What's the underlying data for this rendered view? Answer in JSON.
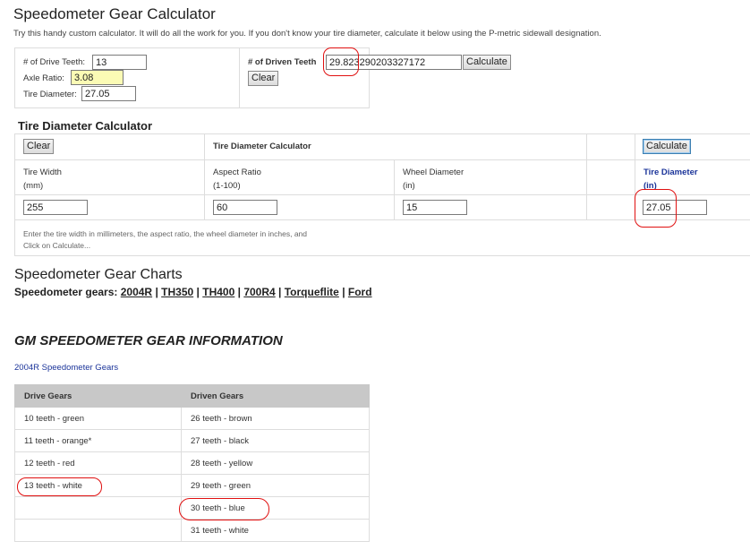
{
  "header": {
    "title": "Speedometer Gear Calculator",
    "intro": "Try this handy custom calculator. It will do all the work for you. If you don't know your tire diameter, calculate it below using the P-metric sidewall designation."
  },
  "calculator": {
    "drive_teeth_label": "# of Drive Teeth:",
    "drive_teeth_value": "13",
    "axle_ratio_label": "Axle Ratio:",
    "axle_ratio_value": "3.08",
    "tire_diameter_label": "Tire Diameter:",
    "tire_diameter_value": "27.05",
    "driven_teeth_label": "# of Driven Teeth",
    "driven_teeth_value": "29.823290203327172",
    "calculate_label": "Calculate",
    "clear_label": "Clear"
  },
  "tire_calc": {
    "heading": "Tire Diameter Calculator",
    "clear_label": "Clear",
    "header_label": "Tire Diameter Calculator",
    "calculate_label": "Calculate",
    "width_label": "Tire Width",
    "width_unit": "(mm)",
    "width_value": "255",
    "aspect_label": "Aspect Ratio",
    "aspect_unit": "(1-100)",
    "aspect_value": "60",
    "wheel_label": "Wheel Diameter",
    "wheel_unit": "(in)",
    "wheel_value": "15",
    "diameter_label": "Tire Diameter",
    "diameter_unit": "(in)",
    "diameter_value": "27.05",
    "help_line1": "Enter the tire width in millimeters, the aspect ratio, the wheel diameter in inches, and",
    "help_line2": "Click on Calculate..."
  },
  "charts": {
    "heading": "Speedometer Gear Charts",
    "prefix": "Speedometer gears:",
    "links": [
      "2004R",
      "TH350",
      "TH400",
      "700R4",
      "Torqueflite",
      "Ford"
    ],
    "separator": "|"
  },
  "gm": {
    "heading": "GM SPEEDOMETER GEAR INFORMATION",
    "subheading": "2004R Speedometer Gears",
    "columns": [
      "Drive Gears",
      "Driven Gears"
    ],
    "rows": [
      [
        "10 teeth - green",
        "26 teeth - brown"
      ],
      [
        "11 teeth - orange*",
        "27 teeth - black"
      ],
      [
        "12 teeth - red",
        "28 teeth - yellow"
      ],
      [
        "13 teeth - white",
        "29 teeth - green"
      ],
      [
        "",
        "30 teeth - blue"
      ],
      [
        "",
        "31 teeth - white"
      ]
    ]
  },
  "colors": {
    "annotation": "#e01010",
    "link_blue": "#1a3399",
    "highlight_input": "#fbfbb5"
  }
}
